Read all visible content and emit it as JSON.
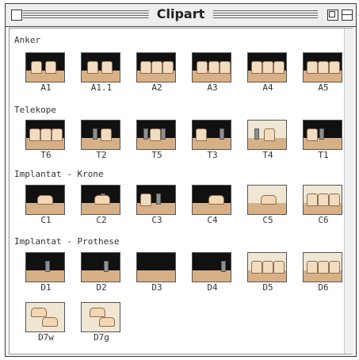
{
  "window": {
    "title": "Clipart"
  },
  "sections": [
    {
      "label": "Anker",
      "items": [
        "A1",
        "A1.1",
        "A2",
        "A3",
        "A4",
        "A5"
      ]
    },
    {
      "label": "Telekope",
      "items": [
        "T6",
        "T2",
        "T5",
        "T3",
        "T4",
        "T1"
      ]
    },
    {
      "label": "Implantat - Krone",
      "items": [
        "C1",
        "C2",
        "C3",
        "C4",
        "C5",
        "C6"
      ]
    },
    {
      "label": "Implantat - Prothese",
      "items": [
        "D1",
        "D2",
        "D3",
        "D4",
        "D5",
        "D6",
        "D7w",
        "D7g"
      ]
    }
  ],
  "icons": {
    "close": "close-icon",
    "zoom": "zoom-icon",
    "collapse": "collapse-icon",
    "tooth_thumbnail": "tooth-icon"
  }
}
